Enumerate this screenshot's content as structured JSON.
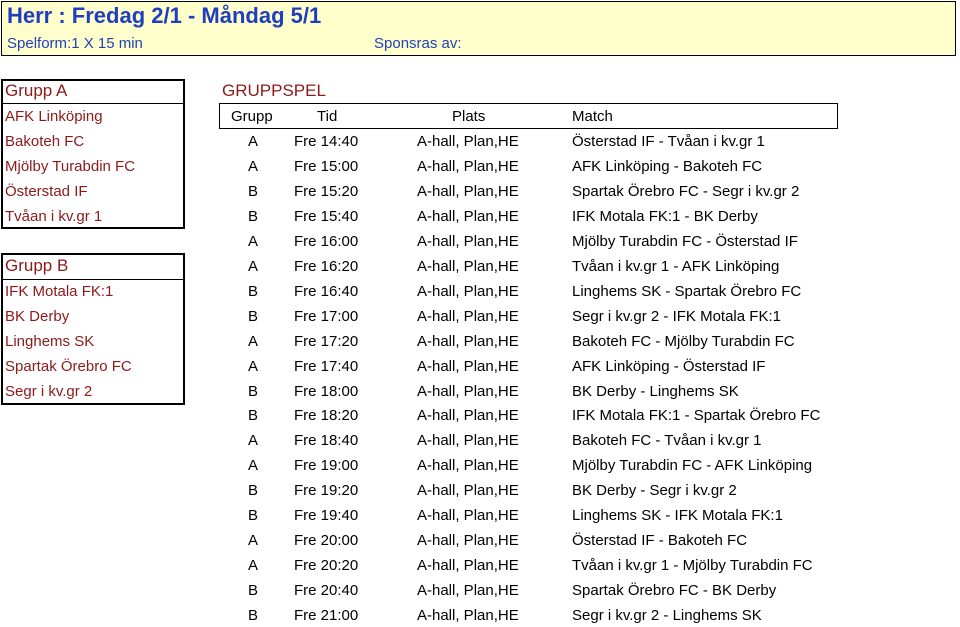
{
  "header": {
    "title": "Herr : Fredag 2/1 - Måndag 5/1",
    "format": "Spelform:1 X 15 min",
    "sponsor": "Sponsras av:"
  },
  "group_a": {
    "label": "Grupp A",
    "teams": [
      "AFK Linköping",
      "Bakoteh FC",
      "Mjölby Turabdin FC",
      "Österstad IF",
      "Tvåan i kv.gr 1"
    ]
  },
  "group_b": {
    "label": "Grupp B",
    "teams": [
      "IFK Motala FK:1",
      "BK Derby",
      "Linghems SK",
      "Spartak Örebro FC",
      "Segr i kv.gr 2"
    ]
  },
  "schedule": {
    "title": "GRUPPSPEL",
    "headers": {
      "group": "Grupp",
      "time": "Tid",
      "venue": "Plats",
      "match": "Match"
    },
    "rows": [
      {
        "group": "A",
        "time": "Fre 14:40",
        "venue": "A-hall, Plan,HE",
        "match": "Österstad IF  -  Tvåan i kv.gr 1"
      },
      {
        "group": "A",
        "time": "Fre 15:00",
        "venue": "A-hall, Plan,HE",
        "match": "AFK Linköping  -  Bakoteh FC"
      },
      {
        "group": "B",
        "time": "Fre 15:20",
        "venue": "A-hall, Plan,HE",
        "match": "Spartak Örebro FC  -  Segr i kv.gr 2"
      },
      {
        "group": "B",
        "time": "Fre 15:40",
        "venue": "A-hall, Plan,HE",
        "match": "IFK Motala FK:1  -  BK Derby"
      },
      {
        "group": "A",
        "time": "Fre 16:00",
        "venue": "A-hall, Plan,HE",
        "match": "Mjölby Turabdin FC  -  Österstad IF"
      },
      {
        "group": "A",
        "time": "Fre 16:20",
        "venue": "A-hall, Plan,HE",
        "match": "Tvåan i kv.gr 1  -  AFK Linköping"
      },
      {
        "group": "B",
        "time": "Fre 16:40",
        "venue": "A-hall, Plan,HE",
        "match": "Linghems SK  -  Spartak Örebro FC"
      },
      {
        "group": "B",
        "time": "Fre 17:00",
        "venue": "A-hall, Plan,HE",
        "match": "Segr i kv.gr 2  -  IFK Motala FK:1"
      },
      {
        "group": "A",
        "time": "Fre 17:20",
        "venue": "A-hall, Plan,HE",
        "match": "Bakoteh FC  -  Mjölby Turabdin FC"
      },
      {
        "group": "A",
        "time": "Fre 17:40",
        "venue": "A-hall, Plan,HE",
        "match": "AFK Linköping  -  Österstad IF"
      },
      {
        "group": "B",
        "time": "Fre 18:00",
        "venue": "A-hall, Plan,HE",
        "match": "BK Derby  -  Linghems SK"
      },
      {
        "group": "B",
        "time": "Fre 18:20",
        "venue": "A-hall, Plan,HE",
        "match": "IFK Motala FK:1  -  Spartak Örebro FC"
      },
      {
        "group": "A",
        "time": "Fre 18:40",
        "venue": "A-hall, Plan,HE",
        "match": "Bakoteh FC  -  Tvåan i kv.gr 1"
      },
      {
        "group": "A",
        "time": "Fre 19:00",
        "venue": "A-hall, Plan,HE",
        "match": "Mjölby Turabdin FC  -  AFK Linköping"
      },
      {
        "group": "B",
        "time": "Fre 19:20",
        "venue": "A-hall, Plan,HE",
        "match": "BK Derby  -  Segr i kv.gr 2"
      },
      {
        "group": "B",
        "time": "Fre 19:40",
        "venue": "A-hall, Plan,HE",
        "match": "Linghems SK  -  IFK Motala FK:1"
      },
      {
        "group": "A",
        "time": "Fre 20:00",
        "venue": "A-hall, Plan,HE",
        "match": "Österstad IF  -  Bakoteh FC"
      },
      {
        "group": "A",
        "time": "Fre 20:20",
        "venue": "A-hall, Plan,HE",
        "match": "Tvåan i kv.gr 1  -  Mjölby Turabdin FC"
      },
      {
        "group": "B",
        "time": "Fre 20:40",
        "venue": "A-hall, Plan,HE",
        "match": "Spartak Örebro FC  -  BK Derby"
      },
      {
        "group": "B",
        "time": "Fre 21:00",
        "venue": "A-hall, Plan,HE",
        "match": "Segr i kv.gr 2  -  Linghems SK"
      }
    ]
  },
  "colors": {
    "title_blue": "#1f3fbf",
    "header_bg": "#ffffcc",
    "team_red": "#8b1a1a"
  }
}
